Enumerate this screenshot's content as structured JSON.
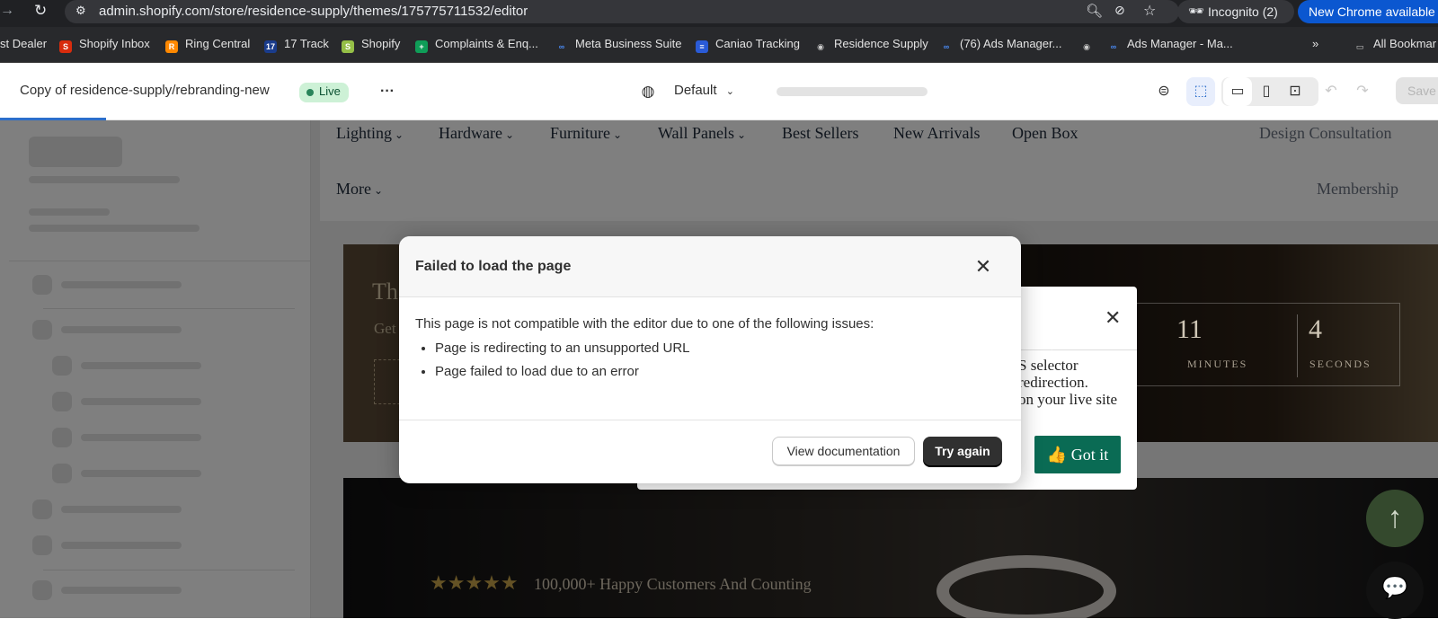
{
  "browser": {
    "url": "admin.shopify.com/store/residence-supply/themes/175775711532/editor",
    "incognito_label": "Incognito (2)",
    "new_chrome_label": "New Chrome available",
    "bookmarks": [
      {
        "label": "st Dealer"
      },
      {
        "label": "Shopify Inbox"
      },
      {
        "label": "Ring Central"
      },
      {
        "label": "17 Track"
      },
      {
        "label": "Shopify"
      },
      {
        "label": "Complaints & Enq..."
      },
      {
        "label": "Meta Business Suite"
      },
      {
        "label": "Caniao Tracking"
      },
      {
        "label": "Residence Supply"
      },
      {
        "label": "(76) Ads Manager..."
      },
      {
        "label": "Ads Manager - Ma..."
      }
    ],
    "all_bookmarks_label": "All Bookmar"
  },
  "editor": {
    "theme_name": "Copy of residence-supply/rebranding-new",
    "live_badge": "Live",
    "template_label": "Default",
    "save_label": "Save"
  },
  "preview": {
    "nav_items": [
      "Lighting",
      "Hardware",
      "Furniture",
      "Wall Panels",
      "Best Sellers",
      "New Arrivals",
      "Open Box",
      "Design Consultation",
      "More",
      "Membership"
    ],
    "hero_partial_1": "Th",
    "hero_partial_2": "Get",
    "countdown": {
      "minutes_value": "11",
      "minutes_label": "MINUTES",
      "seconds_value": "4",
      "seconds_label": "SECONDS"
    },
    "popup_text_1": "S selector",
    "popup_text_2": "redirection.",
    "popup_text_3": "on your live site",
    "got_it_label": "👍 Got it",
    "stars": "★★★★★",
    "happy_text": "100,000+ Happy Customers And Counting"
  },
  "modal": {
    "title": "Failed to load the page",
    "intro": "This page is not compatible with the editor due to one of the following issues:",
    "issues": [
      "Page is redirecting to an unsupported URL",
      "Page failed to load due to an error"
    ],
    "view_doc_label": "View documentation",
    "try_again_label": "Try again"
  },
  "colors": {
    "accent": "#2c6ecb",
    "live_bg": "#cdf1d6",
    "new_chrome": "#0b57d0",
    "got_it": "#0a6b54"
  }
}
